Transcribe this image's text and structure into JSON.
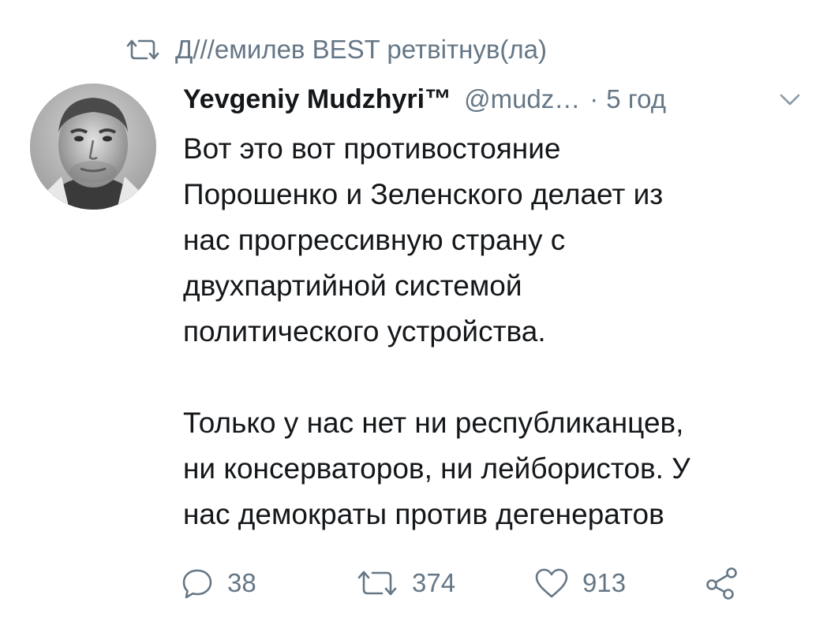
{
  "retweet": {
    "text": "Д///емилев BEST ретвітнув(ла)",
    "icon": "retweet-icon"
  },
  "tweet": {
    "display_name": "Yevgeniy Mudzhyri™",
    "handle": "@mudz…",
    "separator": "·",
    "time": "5 год",
    "paragraphs": [
      "Вот это вот противостояние\nПорошенко и Зеленского делает из\nнас прогрессивную страну с\nдвухпартийной системой\nполитического устройства.",
      "Только у нас нет ни республиканцев,\nни консерваторов, ни лейбористов. У\nнас демократы против дегенератов"
    ]
  },
  "actions": {
    "reply_count": "38",
    "retweet_count": "374",
    "like_count": "913"
  },
  "colors": {
    "text": "#14171a",
    "muted": "#657786",
    "background": "#ffffff"
  }
}
